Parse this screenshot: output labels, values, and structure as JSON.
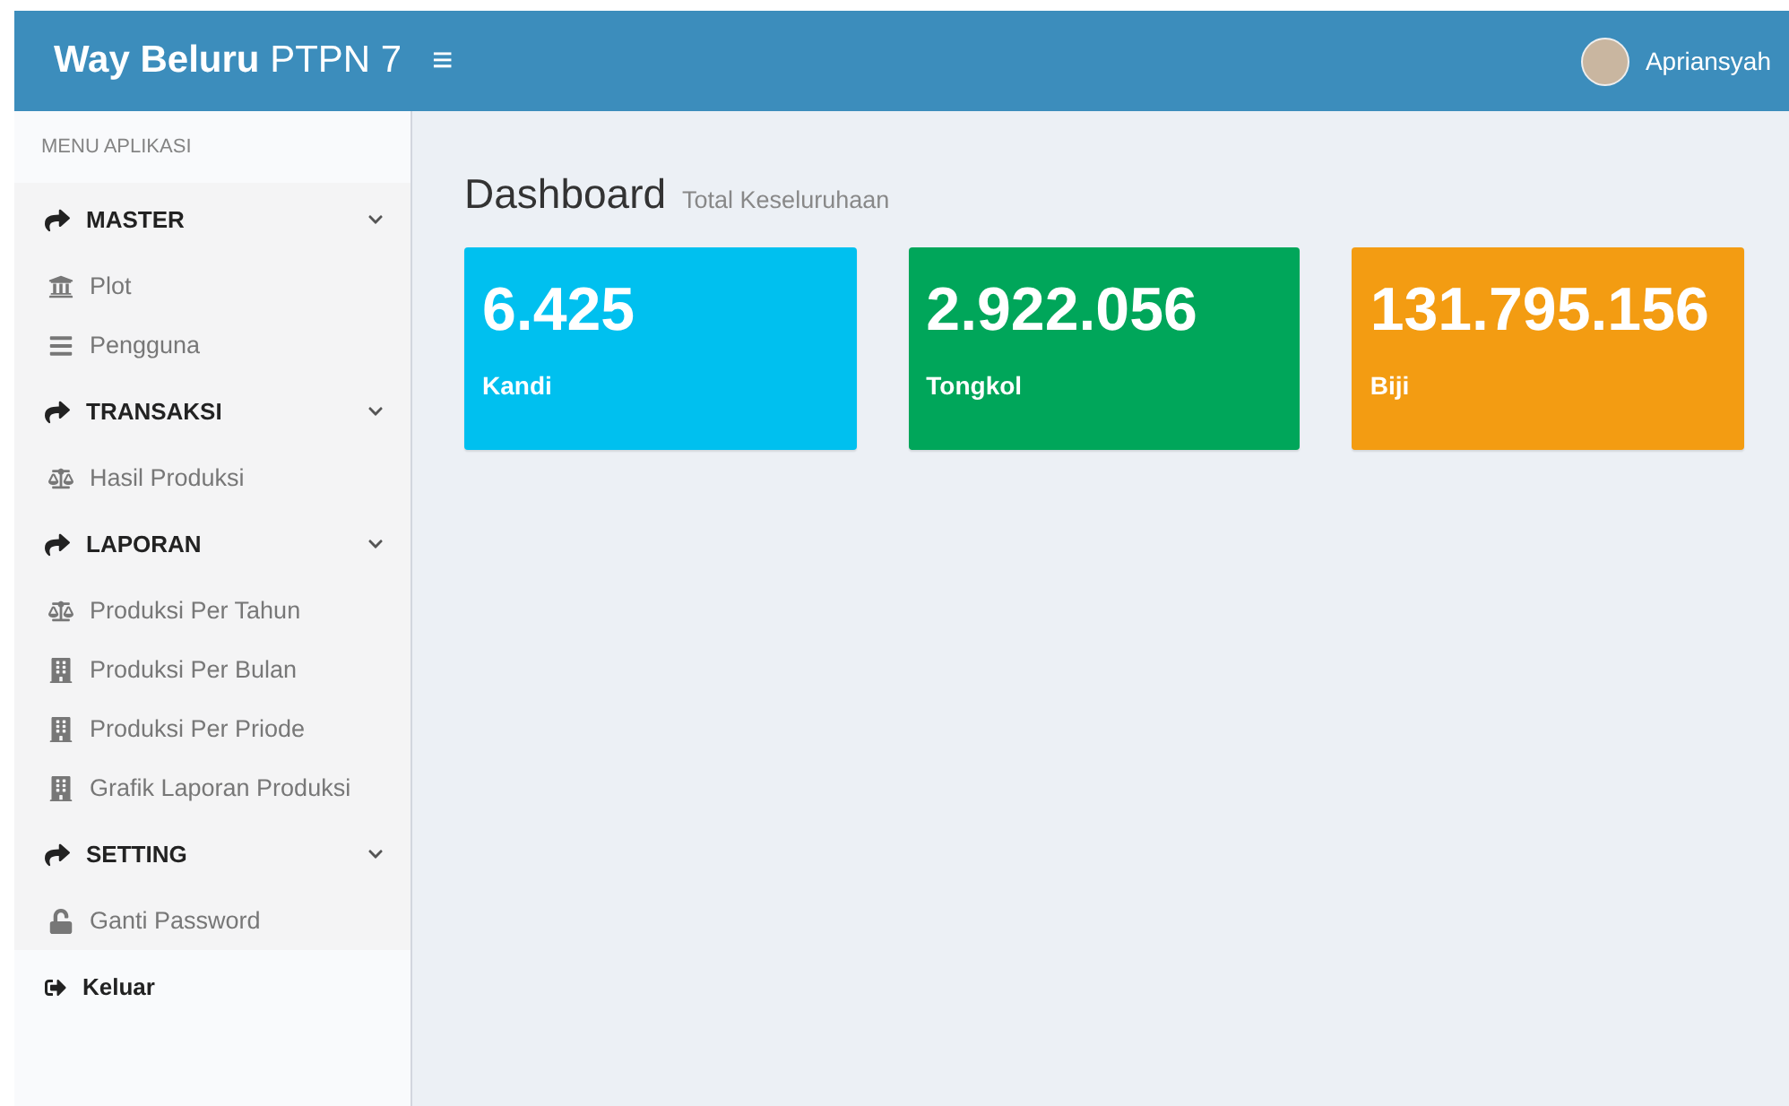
{
  "header": {
    "brand": "**Way Beluru** PTPN 7",
    "toggle": "≡",
    "user": "Apriansyah"
  },
  "sidebar": {
    "heading": "MENU APLIKASI",
    "items": [
      {
        "kind": "section",
        "label": "MASTER",
        "expanded": true,
        "children": [
          {
            "label": "Plot"
          },
          {
            "label": "Pengguna"
          }
        ]
      },
      {
        "kind": "section",
        "label": "TRANSAKSI",
        "expanded": true,
        "children": [
          {
            "label": "Hasil Produksi"
          }
        ]
      },
      {
        "kind": "section",
        "label": "LAPORAN",
        "expanded": true,
        "children": [
          {
            "label": "Produksi Per Tahun"
          },
          {
            "label": "Produksi Per Bulan"
          },
          {
            "label": "Produksi Per Priode"
          },
          {
            "label": "Grafik Laporan Produksi"
          }
        ]
      },
      {
        "kind": "section",
        "label": "SETTING",
        "expanded": true,
        "children": [
          {
            "label": "Ganti Password"
          }
        ]
      },
      {
        "kind": "link",
        "label": "Keluar"
      }
    ]
  },
  "content": {
    "title": "Dashboard",
    "subtitle": "Total Keseluruhaan",
    "cards": [
      {
        "value": "6.425",
        "label": "Kandi",
        "color": "#00c0ef"
      },
      {
        "value": "2.922.056",
        "label": "Tongkol",
        "color": "#00a65a"
      },
      {
        "value": "131.795.156",
        "label": "Biji",
        "color": "#f39c12"
      }
    ]
  }
}
